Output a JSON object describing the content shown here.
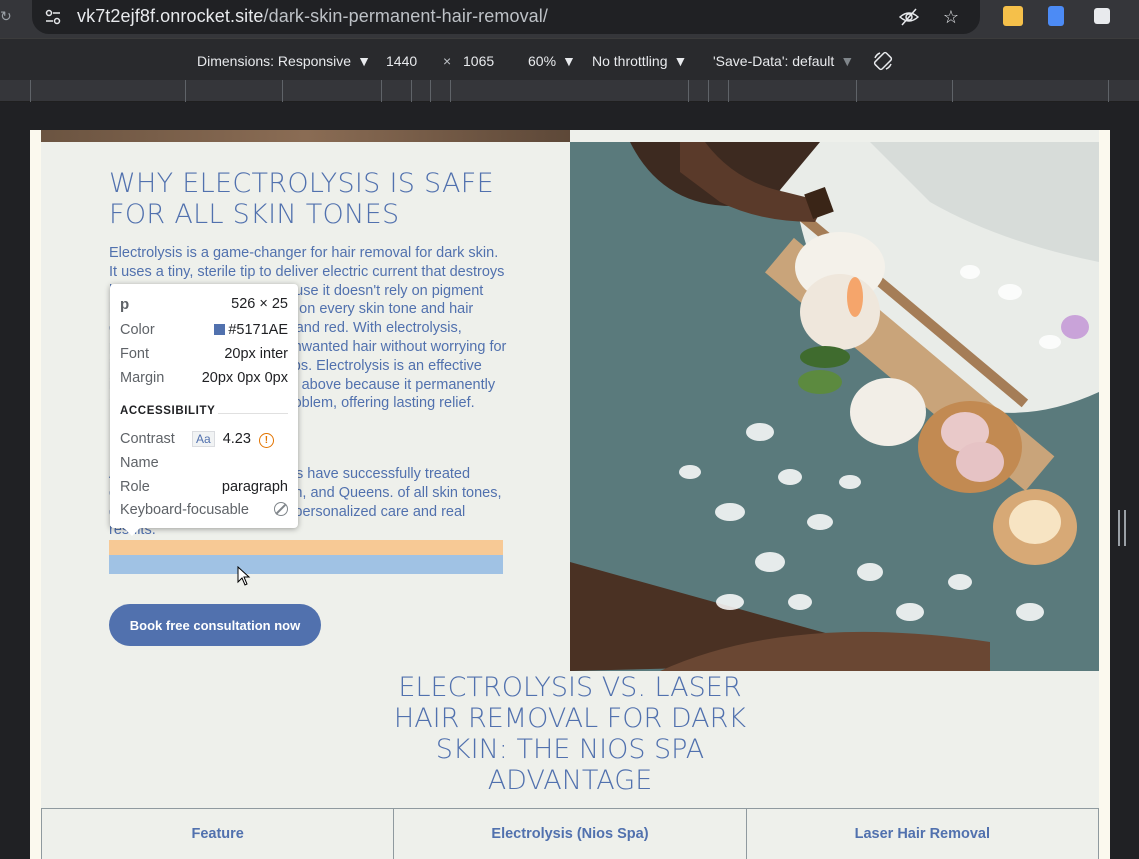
{
  "browser": {
    "url_host": "vk7t2ejf8f.onrocket.site",
    "url_path": "/dark-skin-permanent-hair-removal/"
  },
  "device_toolbar": {
    "dimensions_label": "Dimensions: Responsive",
    "width": "1440",
    "times": "×",
    "height": "1065",
    "zoom": "60%",
    "throttling": "No throttling",
    "save_data": "'Save-Data': default"
  },
  "section1": {
    "heading": "WHY ELECTROLYSIS IS SAFE FOR ALL SKIN TONES",
    "paragraph1": "Electrolysis is a game-changer for hair removal for dark skin. It uses a tiny, sterile tip to deliver electric current that destroys hair follicles at the root. Because it doesn't rely on pigment like lasers, electrolysis works on every skin tone and hair color, including grey, blonde, and red. With electrolysis, people can finally get rid of unwanted hair without worrying for ingrown hairs and razor bumps. Electrolysis is an effective ingrown hair removal solution above because it permanently removes the source of the problem, offering lasting relief.",
    "paragraph2": "At Nios Spa, our electrologists have successfully treated clients in Manhattan, Brooklyn, and Queens. of all skin tones, genders, and hair types with personalized care and real results.",
    "cta_label": "Book free consultation now"
  },
  "section2": {
    "heading": "ELECTROLYSIS VS. LASER HAIR REMOVAL FOR DARK SKIN: THE NIOS SPA ADVANTAGE",
    "table_headers": [
      "Feature",
      "Electrolysis (Nios Spa)",
      "Laser Hair Removal"
    ]
  },
  "inspect_tooltip": {
    "tag": "p",
    "size": "526 × 25",
    "color_label": "Color",
    "color_value": "#5171AE",
    "font_label": "Font",
    "font_value": "20px inter",
    "margin_label": "Margin",
    "margin_value": "20px 0px 0px",
    "accessibility_title": "ACCESSIBILITY",
    "contrast_label": "Contrast",
    "contrast_aa": "Aa",
    "contrast_value": "4.23",
    "name_label": "Name",
    "role_label": "Role",
    "role_value": "paragraph",
    "keyboard_label": "Keyboard-focusable"
  },
  "colors": {
    "brand_blue": "#5171ae",
    "page_bg": "#eef0eb",
    "highlight_margin": "#f7c995",
    "highlight_content": "#a0c2e4"
  }
}
